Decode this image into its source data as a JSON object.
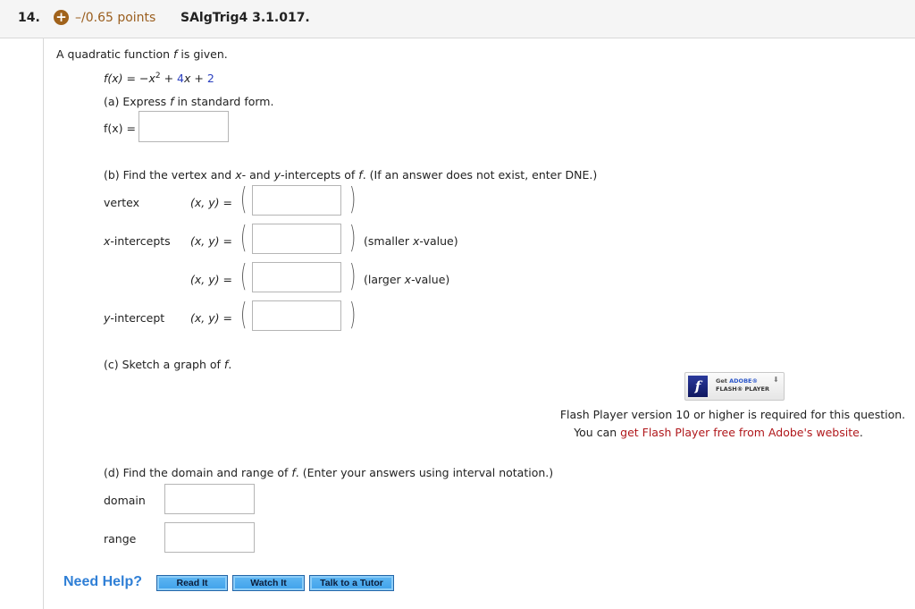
{
  "header": {
    "question_number": "14.",
    "points_icon": "plus-circle-icon",
    "points": "–/0.65 points",
    "question_id": "SAlgTrig4 3.1.017."
  },
  "prompt": {
    "intro_pre": "A quadratic function ",
    "intro_var": "f",
    "intro_post": " is given.",
    "function": {
      "lhs": "f(x)",
      "eq": " = −",
      "x": "x",
      "exp": "2",
      "plus1": " + ",
      "coef_b": "4",
      "x2": "x",
      "plus2": " + ",
      "const_c": "2"
    }
  },
  "part_a": {
    "label_pre": "(a) Express ",
    "label_var": "f",
    "label_post": " in standard form.",
    "answer_label": "f(x) =",
    "answer_value": ""
  },
  "part_b": {
    "instruction_pre": "(b) Find the vertex and ",
    "instruction_x": "x",
    "instruction_mid": "- and ",
    "instruction_y": "y",
    "instruction_mid2": "-intercepts of ",
    "instruction_f": "f",
    "instruction_post": ". (If an answer does not exist, enter DNE.)",
    "coord_label": "(x, y) =",
    "rows": [
      {
        "label": "vertex",
        "note": "",
        "value": ""
      },
      {
        "label_var": "x",
        "label": "-intercepts",
        "note_pre": "(smaller ",
        "note_var": "x",
        "note_post": "-value)",
        "value": ""
      },
      {
        "label": "",
        "note_pre": "(larger ",
        "note_var": "x",
        "note_post": "-value)",
        "value": ""
      },
      {
        "label_var": "y",
        "label": "-intercept",
        "note": "",
        "value": ""
      }
    ]
  },
  "part_c": {
    "label_pre": "(c) Sketch a graph of ",
    "label_var": "f",
    "label_post": ".",
    "flash_badge": {
      "line1_pre": "Get ",
      "line1_brand": "ADOBE®",
      "line2": "FLASH® PLAYER",
      "logo": "f",
      "download_icon": "⬇"
    },
    "flash_message": "Flash Player version 10 or higher is required for this question.",
    "flash_link_pre": "You can ",
    "flash_link": "get Flash Player free from Adobe's website",
    "flash_link_post": "."
  },
  "part_d": {
    "instruction_pre": "(d) Find the domain and range of ",
    "instruction_var": "f",
    "instruction_post": ". (Enter your answers using interval notation.)",
    "domain_label": "domain",
    "domain_value": "",
    "range_label": "range",
    "range_value": ""
  },
  "help": {
    "label": "Need Help?",
    "buttons": [
      "Read It",
      "Watch It",
      "Talk to a Tutor"
    ]
  },
  "colors": {
    "points": "#9a5e1e",
    "link": "#b0171b",
    "help_text": "#2f7fd6",
    "button": "#4aa9ee",
    "coefficient": "#2a3fbf"
  }
}
